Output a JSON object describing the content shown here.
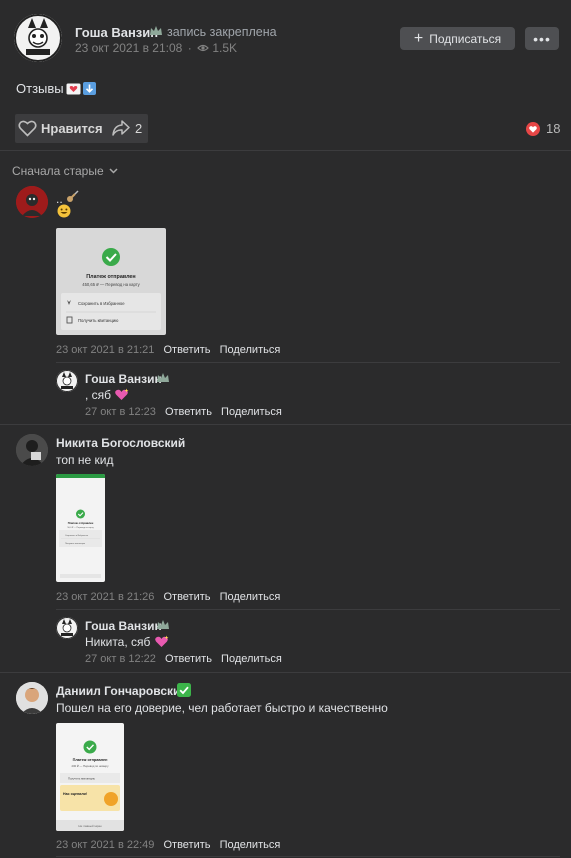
{
  "post": {
    "author": "Гоша Ванзин",
    "pinned_label": "запись закреплена",
    "date": "23 окт 2021 в 21:08",
    "views": "1.5K",
    "subscribe_label": "Подписаться",
    "more_label": "•••",
    "text": "Отзывы",
    "like_label": "Нравится",
    "shares": "2",
    "reactions": "18"
  },
  "sort_label": "Сначала старые",
  "action_labels": {
    "reply": "Ответить",
    "share": "Поделиться"
  },
  "comments": [
    {
      "text": "..",
      "date": "23 окт 2021 в 21:21",
      "image": {
        "title": "Платеж отправлен",
        "subtitle": "450,65 ₽ — Перевод на карту",
        "row1": "Сохранить в Избранное",
        "row2": "Получить квитанцию"
      }
    },
    {
      "author": "Гоша Ванзин",
      "text": ", сяб",
      "date": "27 окт в 12:23"
    },
    {
      "author": "Никита Богословский",
      "text": "топ не кид",
      "date": "23 окт 2021 в 21:26",
      "image": {
        "title": "Платеж отправлен",
        "subtitle": "50,0 ₽ — Перевод на карту",
        "row1": "Сохранить в Избранное",
        "row2": "Получить квитанцию"
      }
    },
    {
      "author": "Гоша Ванзин",
      "text": "Никита, сяб",
      "date": "27 окт в 12:22"
    },
    {
      "author": "Даниил Гончаровский",
      "text": "Пошел на его доверие, чел работает быстро и качественно",
      "date": "23 окт 2021 в 22:49",
      "image": {
        "title": "Платеж отправлен",
        "subtitle": "200 ₽ — Перевод по номеру",
        "row1": "Получить квитанцию",
        "promo": "Нас оценили!",
        "footer": "На главный экран"
      }
    }
  ]
}
